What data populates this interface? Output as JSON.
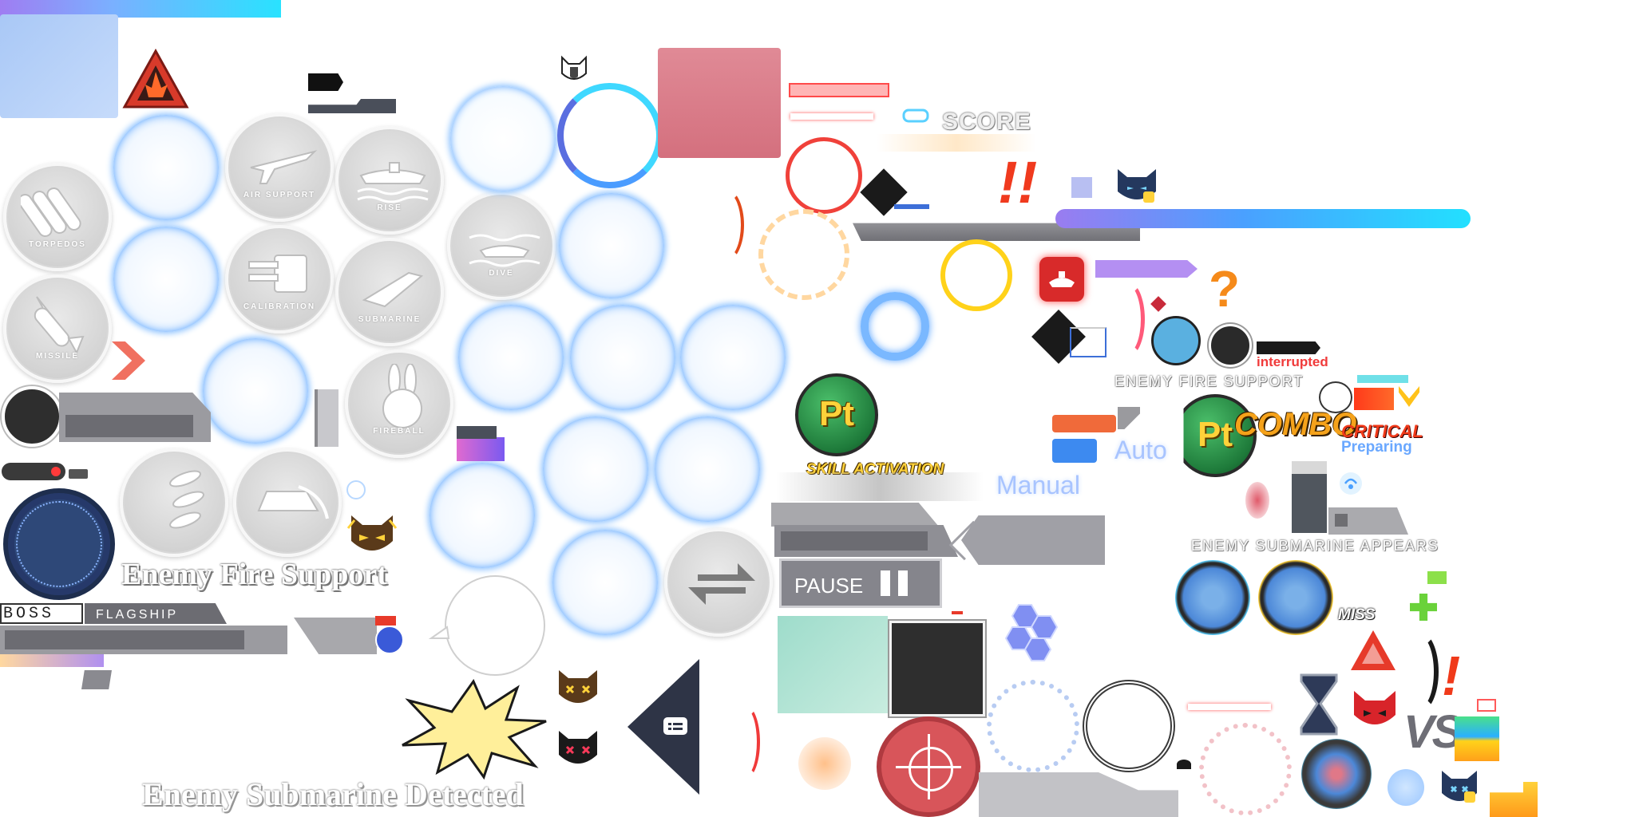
{
  "skills": {
    "torpedos": "TORPEDOS",
    "air_support": "AIR SUPPORT",
    "rise": "RISE",
    "missile": "MISSILE",
    "calibration": "CALIBRATION",
    "submarine": "SUBMARINE",
    "dive": "DIVE",
    "fireball": "FIREBALL"
  },
  "labels": {
    "score": "SCORE",
    "enemy_fire_support_small": "ENEMY FIRE SUPPORT",
    "interrupted": "interrupted",
    "combo": "COMBO",
    "critical": "CRITICAL",
    "preparing": "Preparing",
    "skill_activation": "SKILL ACTIVATION",
    "auto": "Auto",
    "manual": "Manual",
    "enemy_submarine_appears": "ENEMY SUBMARINE APPEARS",
    "miss": "MISS",
    "vs": "VS",
    "pause": "PAUSE",
    "enemy_fire_support": "Enemy Fire Support",
    "enemy_submarine_detected": "Enemy Submarine Detected",
    "boss": "BOSS",
    "flagship": "FLAGSHIP",
    "pt": "Pt",
    "exclaim": "!!",
    "question": "?",
    "bang": "!"
  },
  "colors": {
    "accent_blue": "#5aa4ff",
    "alert_red": "#e0302f",
    "score_orange": "#f0a020",
    "cyan": "#22e0ff",
    "navy": "#2e4878",
    "pt_green": "#1e7a3a"
  }
}
